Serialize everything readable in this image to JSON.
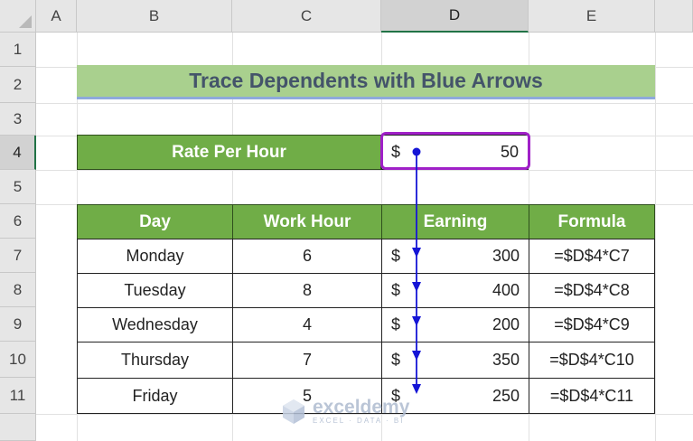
{
  "columns": [
    "A",
    "B",
    "C",
    "D",
    "E"
  ],
  "rows": [
    "1",
    "2",
    "3",
    "4",
    "5",
    "6",
    "7",
    "8",
    "9",
    "10",
    "11"
  ],
  "title": "Trace Dependents with Blue Arrows",
  "rate": {
    "label": "Rate Per Hour",
    "currency": "$",
    "value": "50"
  },
  "headers": {
    "day": "Day",
    "hours": "Work Hour",
    "earning": "Earning",
    "formula": "Formula"
  },
  "table": [
    {
      "day": "Monday",
      "hours": "6",
      "currency": "$",
      "earning": "300",
      "formula": "=$D$4*C7"
    },
    {
      "day": "Tuesday",
      "hours": "8",
      "currency": "$",
      "earning": "400",
      "formula": "=$D$4*C8"
    },
    {
      "day": "Wednesday",
      "hours": "4",
      "currency": "$",
      "earning": "200",
      "formula": "=$D$4*C9"
    },
    {
      "day": "Thursday",
      "hours": "7",
      "currency": "$",
      "earning": "350",
      "formula": "=$D$4*C10"
    },
    {
      "day": "Friday",
      "hours": "5",
      "currency": "$",
      "earning": "250",
      "formula": "=$D$4*C11"
    }
  ],
  "watermark": {
    "name": "exceldemy",
    "tagline": "EXCEL · DATA · BI"
  },
  "colors": {
    "header_green": "#70ad47",
    "title_green": "#a9d08e",
    "selection": "#a020c8",
    "arrow": "#1515d6"
  }
}
